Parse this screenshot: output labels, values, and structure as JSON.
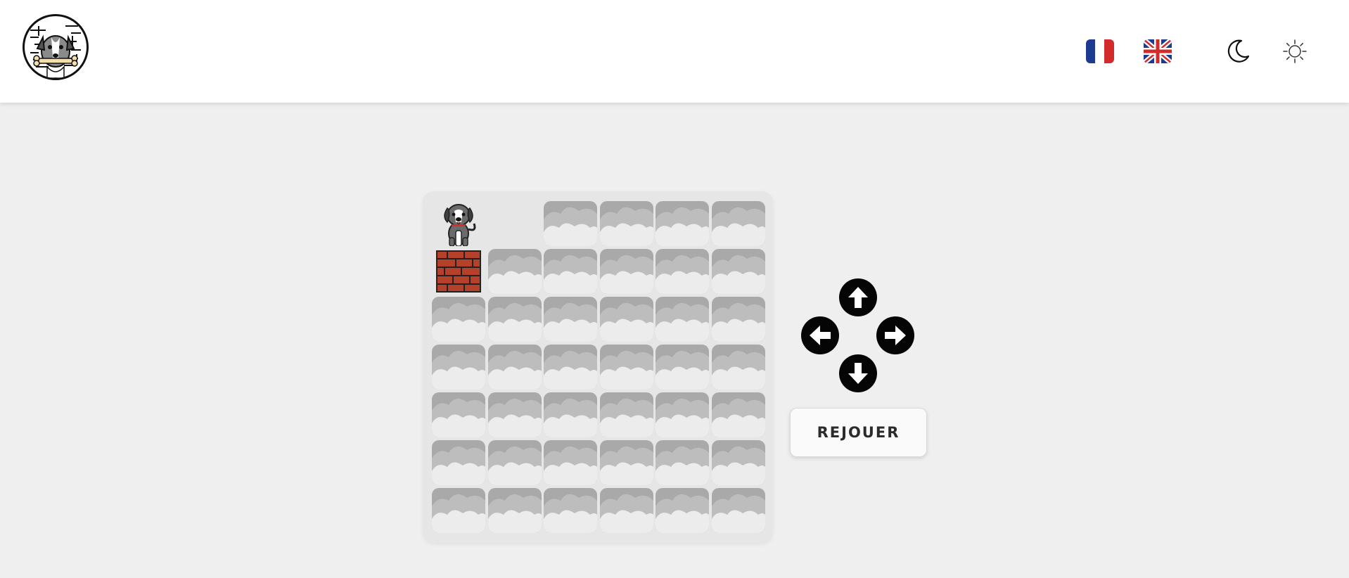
{
  "header": {
    "logo_icon": "dog-maze-logo",
    "languages": [
      {
        "code": "fr",
        "icon": "flag-france-icon"
      },
      {
        "code": "en",
        "icon": "flag-uk-icon"
      }
    ],
    "themes": [
      {
        "mode": "dark",
        "icon": "moon-icon"
      },
      {
        "mode": "light",
        "icon": "sun-icon"
      }
    ]
  },
  "game": {
    "grid_cols": 6,
    "grid_rows": 7,
    "cells": [
      [
        "player",
        "open",
        "fog",
        "fog",
        "fog",
        "fog"
      ],
      [
        "wall",
        "fog",
        "fog",
        "fog",
        "fog",
        "fog"
      ],
      [
        "fog",
        "fog",
        "fog",
        "fog",
        "fog",
        "fog"
      ],
      [
        "fog",
        "fog",
        "fog",
        "fog",
        "fog",
        "fog"
      ],
      [
        "fog",
        "fog",
        "fog",
        "fog",
        "fog",
        "fog"
      ],
      [
        "fog",
        "fog",
        "fog",
        "fog",
        "fog",
        "fog"
      ],
      [
        "fog",
        "fog",
        "fog",
        "fog",
        "fog",
        "fog"
      ]
    ]
  },
  "controls": {
    "arrows": [
      "up",
      "left",
      "right",
      "down"
    ],
    "replay_label": "REJOUER"
  },
  "colors": {
    "page_bg": "#efefef",
    "fog": "#a9a9a9",
    "brick": "#b5412a",
    "arrow_bg": "#050505",
    "flag_blue": "#1c3a8f",
    "flag_red": "#d12b2b"
  }
}
